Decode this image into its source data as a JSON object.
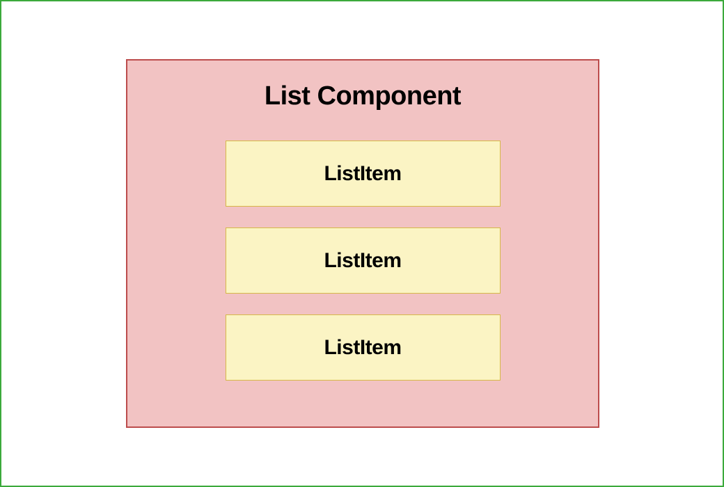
{
  "diagram": {
    "title": "List Component",
    "items": [
      {
        "label": "ListItem"
      },
      {
        "label": "ListItem"
      },
      {
        "label": "ListItem"
      }
    ],
    "colors": {
      "outerBorder": "#3ba93b",
      "componentBg": "#f2c3c3",
      "componentBorder": "#bc4c4c",
      "itemBg": "#fbf4c4",
      "itemBorder": "#d6b846"
    }
  }
}
